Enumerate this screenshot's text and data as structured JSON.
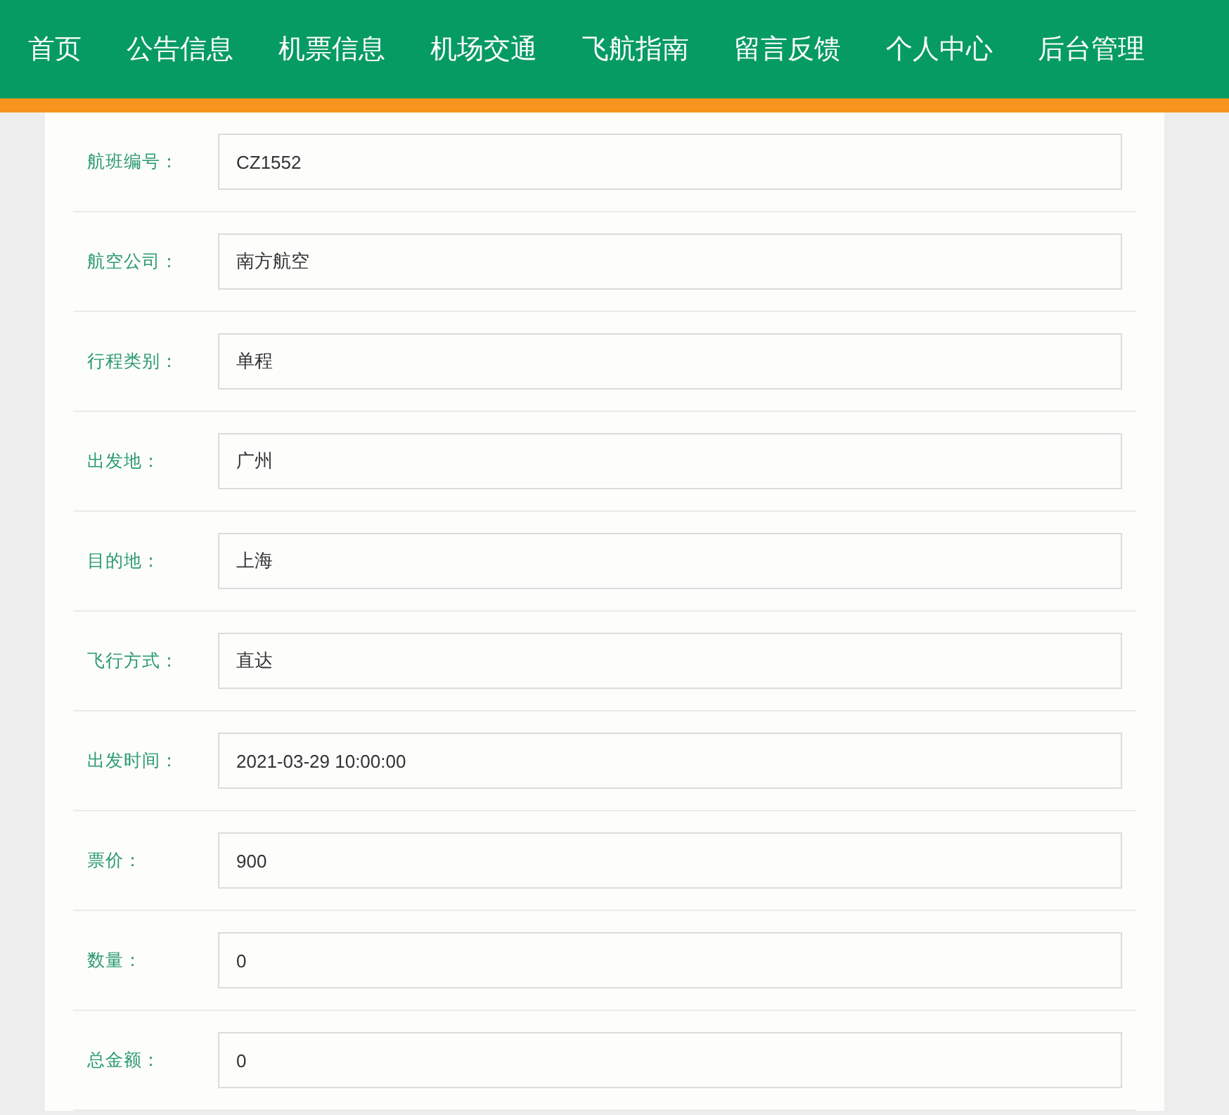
{
  "nav": [
    {
      "label": "首页"
    },
    {
      "label": "公告信息"
    },
    {
      "label": "机票信息"
    },
    {
      "label": "机场交通"
    },
    {
      "label": "飞航指南"
    },
    {
      "label": "留言反馈"
    },
    {
      "label": "个人中心"
    },
    {
      "label": "后台管理"
    }
  ],
  "form": {
    "fields": [
      {
        "label": "航班编号：",
        "value": "CZ1552"
      },
      {
        "label": "航空公司：",
        "value": "南方航空"
      },
      {
        "label": "行程类别：",
        "value": "单程"
      },
      {
        "label": "出发地：",
        "value": "广州"
      },
      {
        "label": "目的地：",
        "value": "上海"
      },
      {
        "label": "飞行方式：",
        "value": "直达"
      },
      {
        "label": "出发时间：",
        "value": "2021-03-29 10:00:00"
      },
      {
        "label": "票价：",
        "value": "900"
      },
      {
        "label": "数量：",
        "value": "0"
      },
      {
        "label": "总金额：",
        "value": "0"
      }
    ]
  }
}
